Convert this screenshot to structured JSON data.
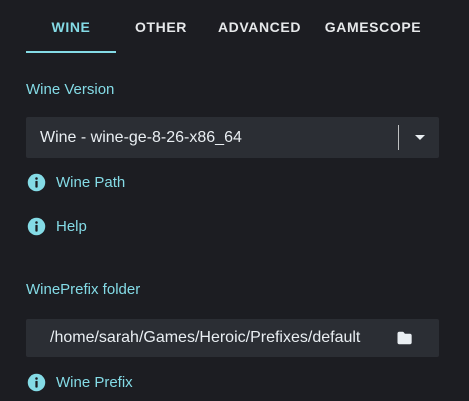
{
  "tabs": [
    {
      "label": "WINE",
      "active": true
    },
    {
      "label": "OTHER",
      "active": false
    },
    {
      "label": "ADVANCED",
      "active": false
    },
    {
      "label": "GAMESCOPE",
      "active": false
    }
  ],
  "wine_version": {
    "label": "Wine Version",
    "selected": "Wine - wine-ge-8-26-x86_64"
  },
  "links": {
    "wine_path": "Wine Path",
    "help": "Help",
    "wine_prefix": "Wine Prefix"
  },
  "wineprefix": {
    "label": "WinePrefix folder",
    "value": "/home/sarah/Games/Heroic/Prefixes/default"
  },
  "icons": {
    "info": "info-icon",
    "dropdown": "chevron-down-icon",
    "folder": "folder-icon"
  },
  "colors": {
    "background": "#1c1d22",
    "accent": "#84dbe6",
    "field": "#2b2e34",
    "text": "#e9eef2"
  }
}
